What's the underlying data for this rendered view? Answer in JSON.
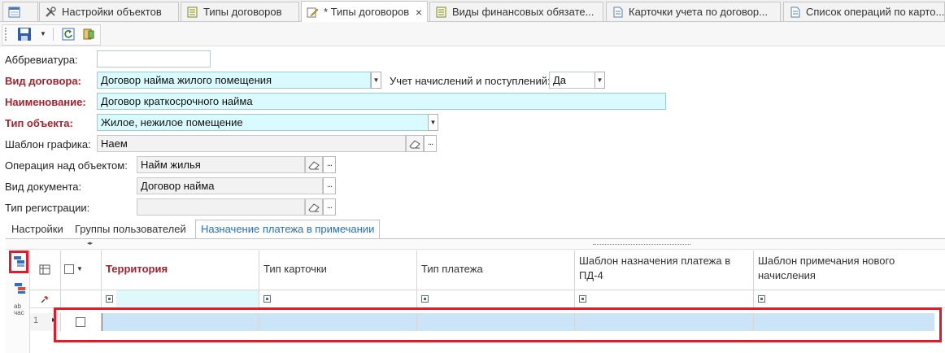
{
  "tabs": [
    {
      "label": "",
      "icon": "grid-icon"
    },
    {
      "label": "Настройки объектов",
      "icon": "tools-icon"
    },
    {
      "label": "Типы договоров",
      "icon": "document-list-icon"
    },
    {
      "label": "* Типы договоров",
      "icon": "edit-document-icon",
      "active": true
    },
    {
      "label": "Виды финансовых обязате...",
      "icon": "document-list-icon"
    },
    {
      "label": "Карточки учета по договор...",
      "icon": "document-icon"
    },
    {
      "label": "Список операций по карто...",
      "icon": "document-icon"
    }
  ],
  "tab_close": "×",
  "toolbar": {
    "items": [
      "save-icon",
      "dropdown-arrow-icon",
      "refresh-icon",
      "exit-icon"
    ]
  },
  "form": {
    "abbreviation": {
      "label": "Аббревиатура:",
      "value": ""
    },
    "contract_kind": {
      "label": "Вид договора:",
      "value": "Договор найма жилого помещения"
    },
    "accounting": {
      "label": "Учет начислений и поступлений:",
      "value": "Да"
    },
    "name": {
      "label": "Наименование:",
      "value": "Договор краткосрочного найма"
    },
    "object_type": {
      "label": "Тип объекта:",
      "value": "Жилое, нежилое помещение"
    },
    "schedule_template": {
      "label": "Шаблон графика:",
      "value": "Наем"
    },
    "object_operation": {
      "label": "Операция над объектом:",
      "value": "Найм жилья"
    },
    "document_kind": {
      "label": "Вид документа:",
      "value": "Договор найма"
    },
    "registration_type": {
      "label": "Тип регистрации:",
      "value": ""
    },
    "ellipsis": "..."
  },
  "inner_tabs": [
    {
      "label": "Настройки"
    },
    {
      "label": "Группы пользователей"
    },
    {
      "label": "Назначение платежа в примечании",
      "active": true
    }
  ],
  "grid": {
    "columns": [
      {
        "label": "Территория",
        "required": true
      },
      {
        "label": "Тип карточки"
      },
      {
        "label": "Тип платежа"
      },
      {
        "label": "Шаблон назначения платежа в ПД-4"
      },
      {
        "label": "Шаблон примечания нового начисления"
      }
    ],
    "rows": [
      {
        "number": "1"
      }
    ],
    "side_tools": [
      "group-by-icon",
      "ungroup-icon",
      "text-wrap-icon"
    ],
    "text_wrap_label": "ab\nчас"
  },
  "colors": {
    "required_label": "#a3232e",
    "required_field": "#d9fbff",
    "selected_row": "#cce4f7",
    "highlight": "#e01c2a",
    "active_tab_text": "#2a6fb5"
  }
}
